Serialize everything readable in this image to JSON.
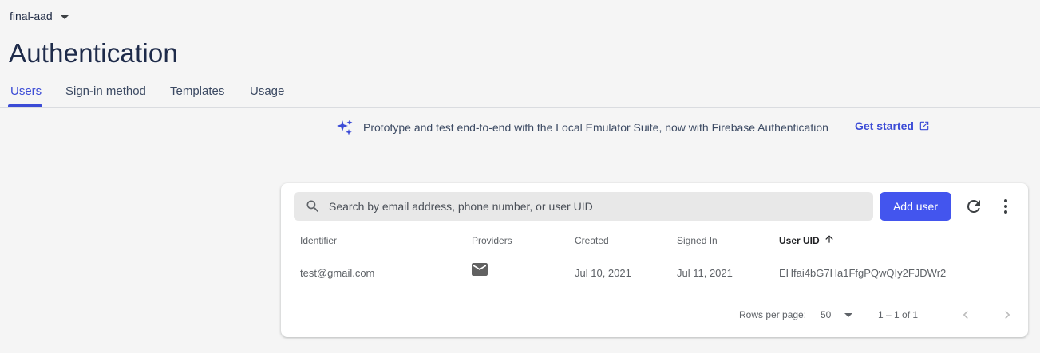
{
  "header": {
    "project_name": "final-aad",
    "page_title": "Authentication"
  },
  "tabs": [
    {
      "label": "Users",
      "active": true
    },
    {
      "label": "Sign-in method",
      "active": false
    },
    {
      "label": "Templates",
      "active": false
    },
    {
      "label": "Usage",
      "active": false
    }
  ],
  "banner": {
    "text": "Prototype and test end-to-end with the Local Emulator Suite, now with Firebase Authentication",
    "link_label": "Get started",
    "icon": "sparkle-icon",
    "link_icon": "open-in-new-icon"
  },
  "users_table": {
    "search_placeholder": "Search by email address, phone number, or user UID",
    "add_user_label": "Add user",
    "columns": [
      "Identifier",
      "Providers",
      "Created",
      "Signed In",
      "User UID"
    ],
    "sorted_column": "User UID",
    "sort_direction": "ascending",
    "rows": [
      {
        "identifier": "test@gmail.com",
        "provider_icon": "mail-icon",
        "created": "Jul 10, 2021",
        "signed_in": "Jul 11, 2021",
        "uid": "EHfai4bG7Ha1FfgPQwQIy2FJDWr2"
      }
    ],
    "pagination": {
      "rows_per_page_label": "Rows per page:",
      "rows_per_page": "50",
      "range_text": "1 – 1 of 1"
    }
  },
  "colors": {
    "accent": "#3b4bd6",
    "button": "#4355ee",
    "background": "#f5f5f5"
  }
}
